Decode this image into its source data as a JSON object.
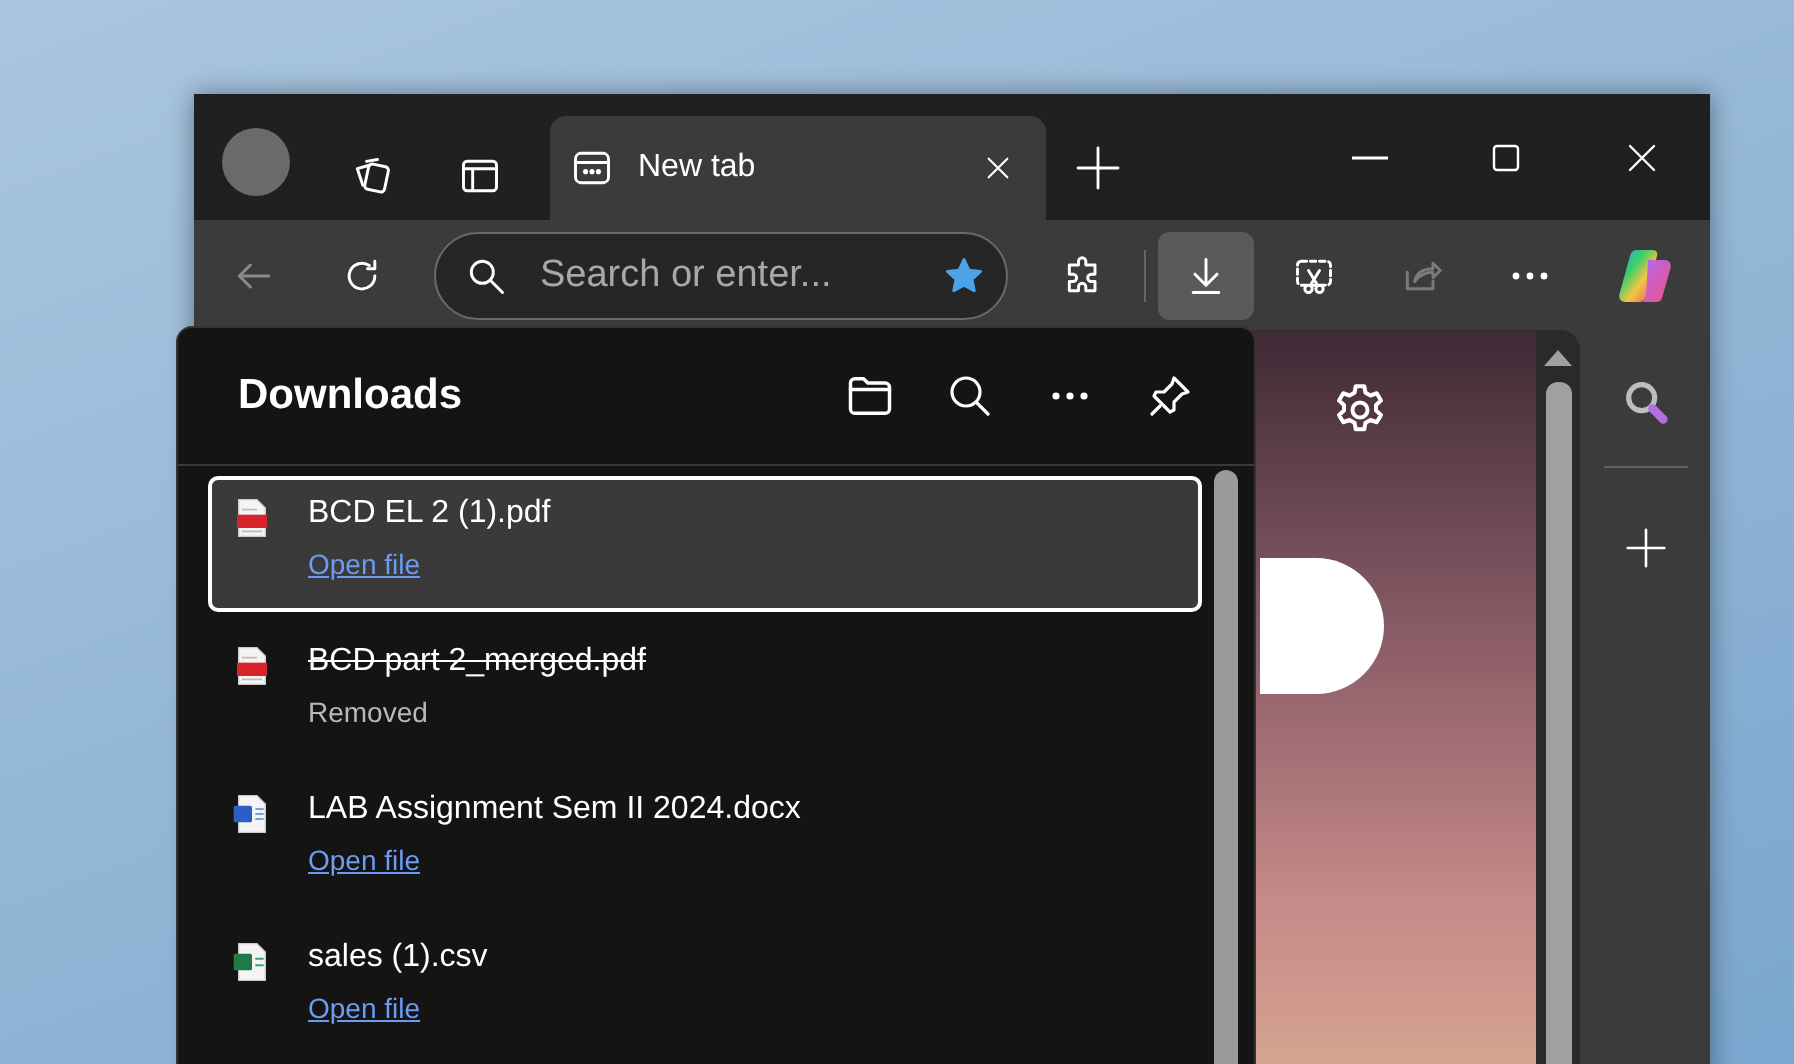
{
  "tab_strip": {
    "tabs": [
      {
        "title": "New tab",
        "selected": true
      }
    ]
  },
  "toolbar": {
    "address": {
      "placeholder": "Search or enter..."
    },
    "favorite": true,
    "downloads_open": true,
    "share_disabled": true
  },
  "downloads": {
    "title": "Downloads",
    "items": [
      {
        "name": "BCD EL 2 (1).pdf",
        "kind": "pdf",
        "removed": false,
        "status": "Open file",
        "selected": true
      },
      {
        "name": "BCD part 2_merged.pdf",
        "kind": "pdf",
        "removed": true,
        "status": "Removed",
        "selected": false
      },
      {
        "name": "LAB Assignment Sem II 2024.docx",
        "kind": "word",
        "removed": false,
        "status": "Open file",
        "selected": false
      },
      {
        "name": "sales (1).csv",
        "kind": "excel",
        "removed": false,
        "status": "Open file",
        "selected": false
      }
    ]
  }
}
